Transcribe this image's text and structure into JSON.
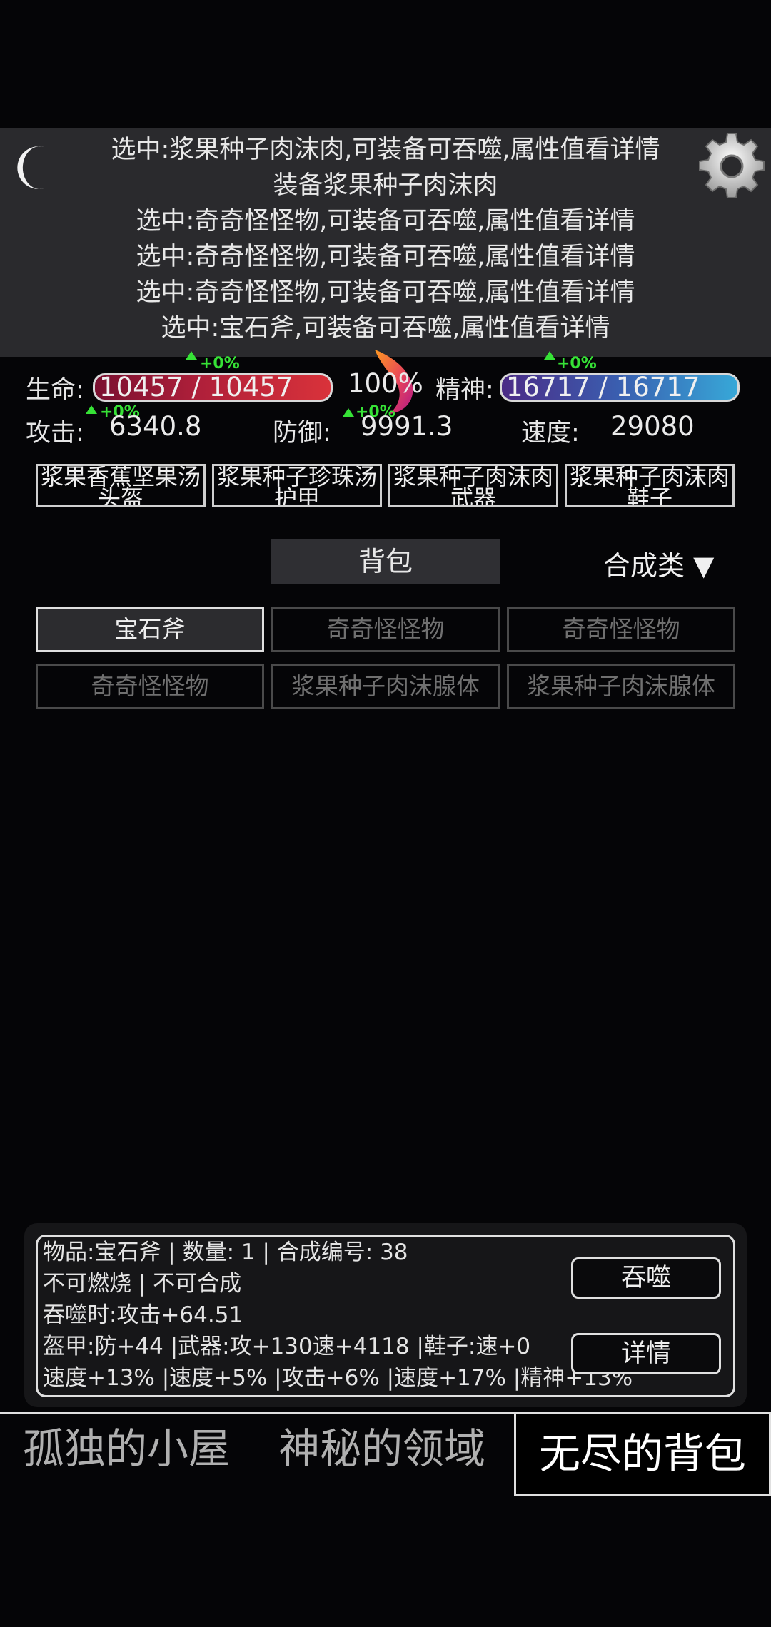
{
  "log": [
    "选中:浆果种子肉沫肉,可装备可吞噬,属性值看详情",
    "装备浆果种子肉沫肉",
    "选中:奇奇怪怪物,可装备可吞噬,属性值看详情",
    "选中:奇奇怪怪物,可装备可吞噬,属性值看详情",
    "选中:奇奇怪怪物,可装备可吞噬,属性值看详情",
    "选中:宝石斧,可装备可吞噬,属性值看详情"
  ],
  "icons": {
    "moon": "moon-icon",
    "settings": "gear-icon",
    "flame": "flame-icon"
  },
  "stats": {
    "hp_label": "生命:",
    "hp_value": "10457 / 10457",
    "hp_fill": 1.0,
    "hp_delta": "+0%",
    "percent": "100%",
    "sp_label": "精神:",
    "sp_value": "16717 / 16717",
    "sp_fill": 1.0,
    "sp_delta": "+0%",
    "atk_label": "攻击:",
    "atk_value": "6340.8",
    "atk_delta": "+0%",
    "def_label": "防御:",
    "def_value": "9991.3",
    "def_delta": "+0%",
    "spd_label": "速度:",
    "spd_value": "29080"
  },
  "equipment": [
    "浆果香蕉坚果汤头盔",
    "浆果种子珍珠汤护甲",
    "浆果种子肉沫肉武器",
    "浆果种子肉沫肉鞋子"
  ],
  "bag": {
    "tab_label": "背包",
    "filter_label": "合成类 ▼"
  },
  "items": [
    {
      "name": "宝石斧",
      "selected": true
    },
    {
      "name": "奇奇怪怪物",
      "selected": false
    },
    {
      "name": "奇奇怪怪物",
      "selected": false
    },
    {
      "name": "奇奇怪怪物",
      "selected": false
    },
    {
      "name": "浆果种子肉沫腺体",
      "selected": false
    },
    {
      "name": "浆果种子肉沫腺体",
      "selected": false
    }
  ],
  "info": {
    "line1": "物品:宝石斧 | 数量: 1 | 合成编号: 38",
    "line2": "不可燃烧 | 不可合成",
    "line3": "吞噬时:攻击+64.51",
    "line4": "盔甲:防+44 |武器:攻+130速+4118 |鞋子:速+0",
    "line5": "速度+13% |速度+5% |攻击+6% |速度+17% |精神+13%",
    "devour_label": "吞噬",
    "detail_label": "详情"
  },
  "nav": {
    "cabin": "孤独的小屋",
    "realm": "神秘的领域",
    "bag": "无尽的背包"
  }
}
